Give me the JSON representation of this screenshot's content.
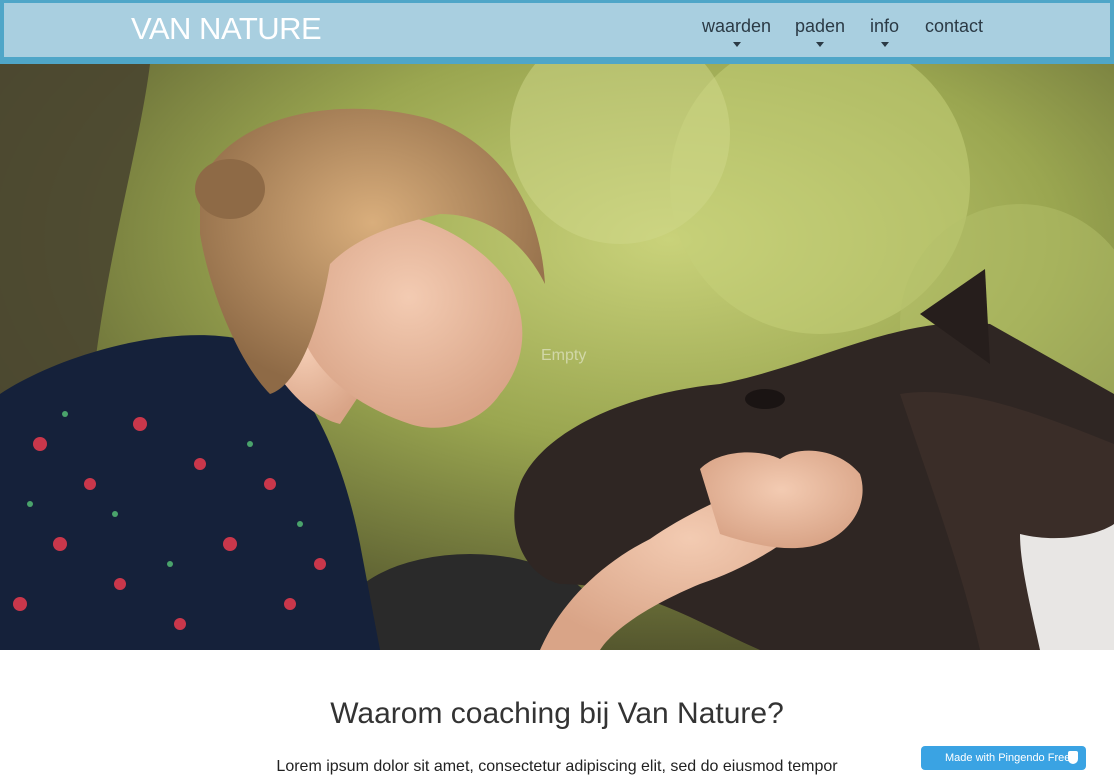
{
  "navbar": {
    "brand": "VAN NATURE",
    "items": [
      {
        "label": "waarden",
        "has_dropdown": true
      },
      {
        "label": "paden",
        "has_dropdown": true
      },
      {
        "label": "info",
        "has_dropdown": true
      },
      {
        "label": "contact",
        "has_dropdown": false
      }
    ]
  },
  "hero": {
    "placeholder_text": "Empty"
  },
  "main": {
    "heading": "Waarom coaching bij Van Nature?",
    "lead": "Lorem ipsum dolor sit amet, consectetur adipiscing elit, sed do eiusmod tempor"
  },
  "badge": {
    "label": "Made with Pingendo Free"
  },
  "colors": {
    "navbar_outer": "#4fa6c8",
    "navbar_inner": "#a9cfe0",
    "badge": "#3aa3e3"
  }
}
